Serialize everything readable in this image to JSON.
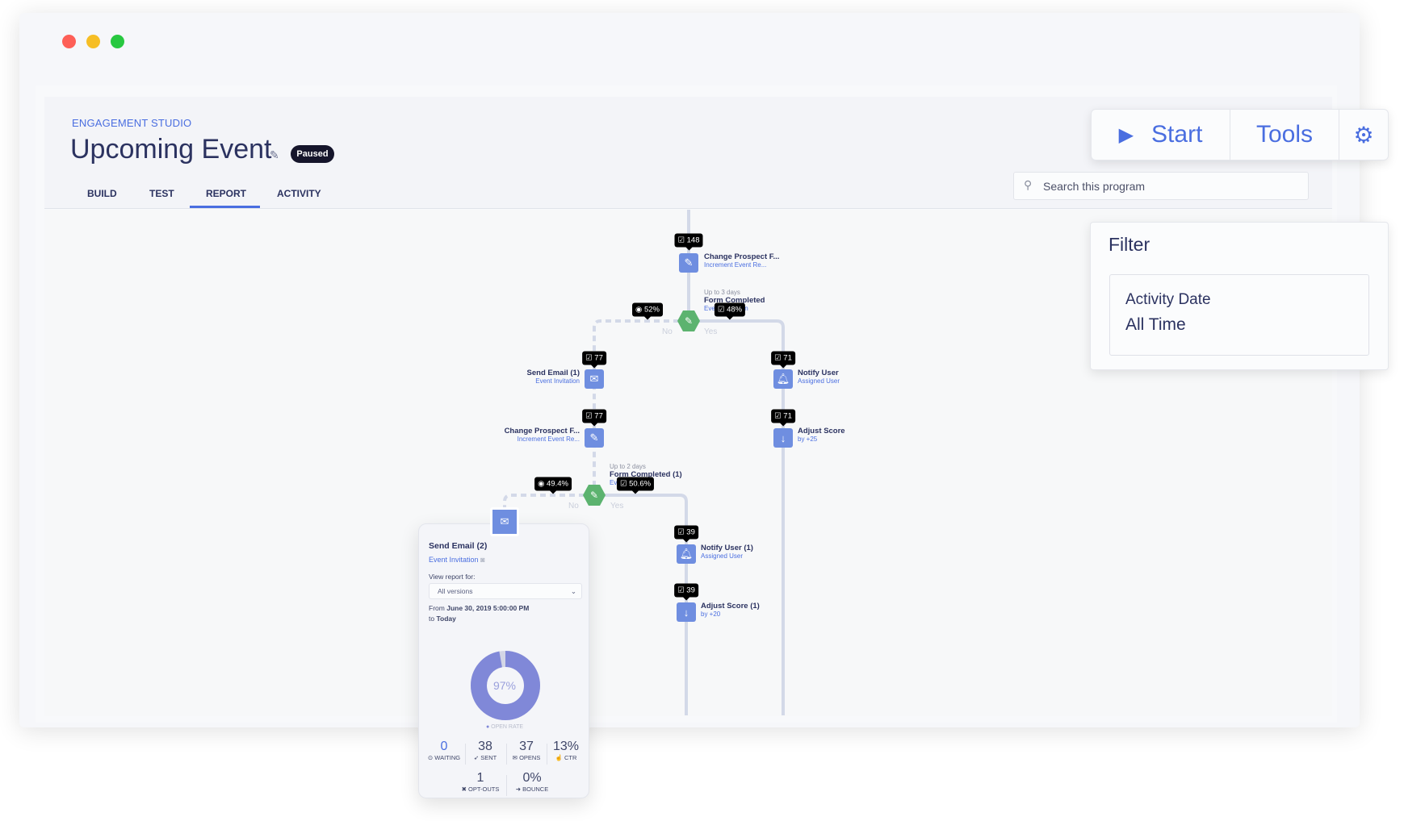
{
  "window": {
    "traffic_lights": [
      "#fe5f57",
      "#f6be25",
      "#28c840"
    ]
  },
  "header": {
    "app": "ENGAGEMENT STUDIO",
    "title": "Upcoming Event",
    "status": "Paused",
    "tabs": [
      {
        "label": "BUILD"
      },
      {
        "label": "TEST"
      },
      {
        "label": "REPORT",
        "active": true
      },
      {
        "label": "ACTIVITY"
      }
    ]
  },
  "toolbar": {
    "start": "Start",
    "tools": "Tools",
    "settings_icon": "gear-icon"
  },
  "search": {
    "placeholder": "Search this program"
  },
  "filter": {
    "title": "Filter",
    "label": "Activity Date",
    "value": "All Time"
  },
  "flow": {
    "n1": {
      "count": "148",
      "title": "Change Prospect F...",
      "sub": "Increment Event Re..."
    },
    "d1": {
      "wait": "Up to 3 days",
      "title": "Form Completed",
      "sub": "Event Invitation",
      "no_pct": "52%",
      "yes_pct": "48%",
      "no": "No",
      "yes": "Yes"
    },
    "n2": {
      "count": "77",
      "title": "Send Email (1)",
      "sub": "Event Invitation"
    },
    "n3": {
      "count": "77",
      "title": "Change Prospect F...",
      "sub": "Increment Event Re..."
    },
    "n4": {
      "count": "71",
      "title": "Notify User",
      "sub": "Assigned User"
    },
    "n5": {
      "count": "71",
      "title": "Adjust Score",
      "sub": "by +25"
    },
    "d2": {
      "wait": "Up to 2 days",
      "title": "Form Completed (1)",
      "sub": "Event Invitation",
      "no_pct": "49.4%",
      "yes_pct": "50.6%",
      "no": "No",
      "yes": "Yes"
    },
    "n6": {
      "count": "39",
      "title": "Notify User (1)",
      "sub": "Assigned User"
    },
    "n7": {
      "count": "39",
      "title": "Adjust Score (1)",
      "sub": "by +20"
    }
  },
  "card": {
    "title": "Send Email (2)",
    "sub": "Event Invitation",
    "view_label": "View report for:",
    "select": "All versions",
    "from_prefix": "From",
    "from": "June 30, 2019 5:00:00 PM",
    "to_prefix": "to",
    "to": "Today",
    "open_rate": 97,
    "open_rate_text": "97%",
    "open_rate_label": "OPEN RATE",
    "stats": [
      {
        "value": "0",
        "label": "WAITING",
        "icon": "clock-icon"
      },
      {
        "value": "38",
        "label": "SENT",
        "icon": "paper-plane-icon"
      },
      {
        "value": "37",
        "label": "OPENS",
        "icon": "envelope-icon"
      },
      {
        "value": "13%",
        "label": "CTR",
        "icon": "pointer-icon"
      },
      {
        "value": "1",
        "label": "OPT-OUTS",
        "icon": "x-icon"
      },
      {
        "value": "0%",
        "label": "BOUNCE",
        "icon": "exit-icon"
      }
    ],
    "colors": {
      "donut": "#8088d8",
      "donut_rest": "#d3d6e6"
    }
  }
}
